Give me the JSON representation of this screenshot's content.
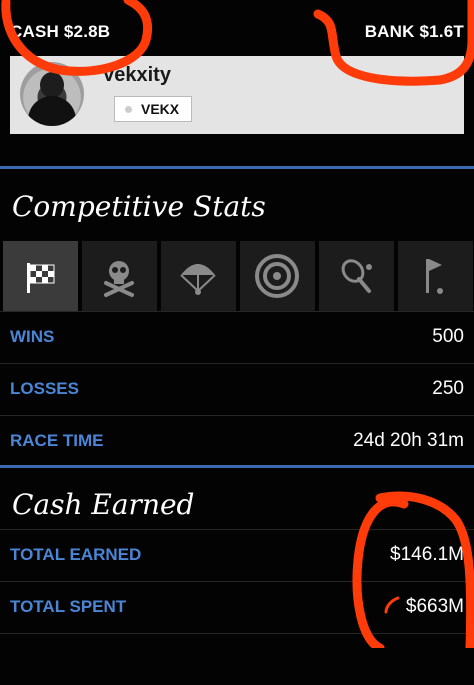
{
  "header": {
    "cash": "CASH $2.8B",
    "bank": "BANK $1.6T"
  },
  "profile": {
    "name": "Vekxity",
    "crew_tag": "VEKX"
  },
  "competitive": {
    "title": "Competitive Stats",
    "tabs": [
      {
        "icon": "checkered-flag-icon",
        "active": true
      },
      {
        "icon": "skull-crossbones-icon",
        "active": false
      },
      {
        "icon": "parachute-icon",
        "active": false
      },
      {
        "icon": "target-icon",
        "active": false
      },
      {
        "icon": "tennis-racket-icon",
        "active": false
      },
      {
        "icon": "golf-flag-icon",
        "active": false
      }
    ],
    "rows": [
      {
        "label": "WINS",
        "value": "500"
      },
      {
        "label": "LOSSES",
        "value": "250"
      },
      {
        "label": "RACE TIME",
        "value": "24d 20h 31m"
      }
    ]
  },
  "cash_earned": {
    "title": "Cash Earned",
    "rows": [
      {
        "label": "TOTAL EARNED",
        "value": "$146.1M"
      },
      {
        "label": "TOTAL SPENT",
        "value": "$663M"
      }
    ]
  },
  "colors": {
    "accent": "#4a85d6",
    "divider": "#3a6ab0",
    "annotation": "#ff3b0a"
  }
}
